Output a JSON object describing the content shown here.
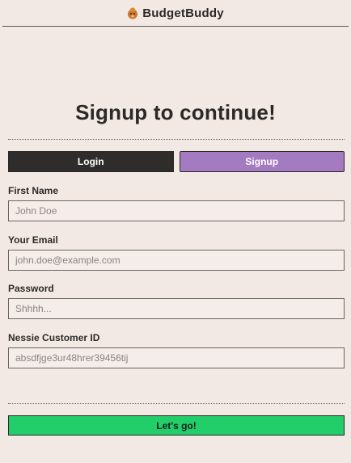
{
  "header": {
    "brand": "BudgetBuddy",
    "logo_icon": "piggy-bank-icon"
  },
  "page_title": "Signup to continue!",
  "tabs": [
    {
      "label": "Login",
      "active": false
    },
    {
      "label": "Signup",
      "active": true
    }
  ],
  "form": {
    "first_name": {
      "label": "First Name",
      "placeholder": "John Doe",
      "value": ""
    },
    "email": {
      "label": "Your Email",
      "placeholder": "john.doe@example.com",
      "value": ""
    },
    "password": {
      "label": "Password",
      "placeholder": "Shhhh...",
      "value": ""
    },
    "customer_id": {
      "label": "Nessie Customer ID",
      "placeholder": "absdfjge3ur48hrer39456tij",
      "value": ""
    },
    "submit_label": "Let's go!"
  },
  "colors": {
    "background": "#f3e9e4",
    "login_tab": "#2e2d2b",
    "signup_tab": "#a47bc1",
    "submit": "#22ce6a"
  }
}
